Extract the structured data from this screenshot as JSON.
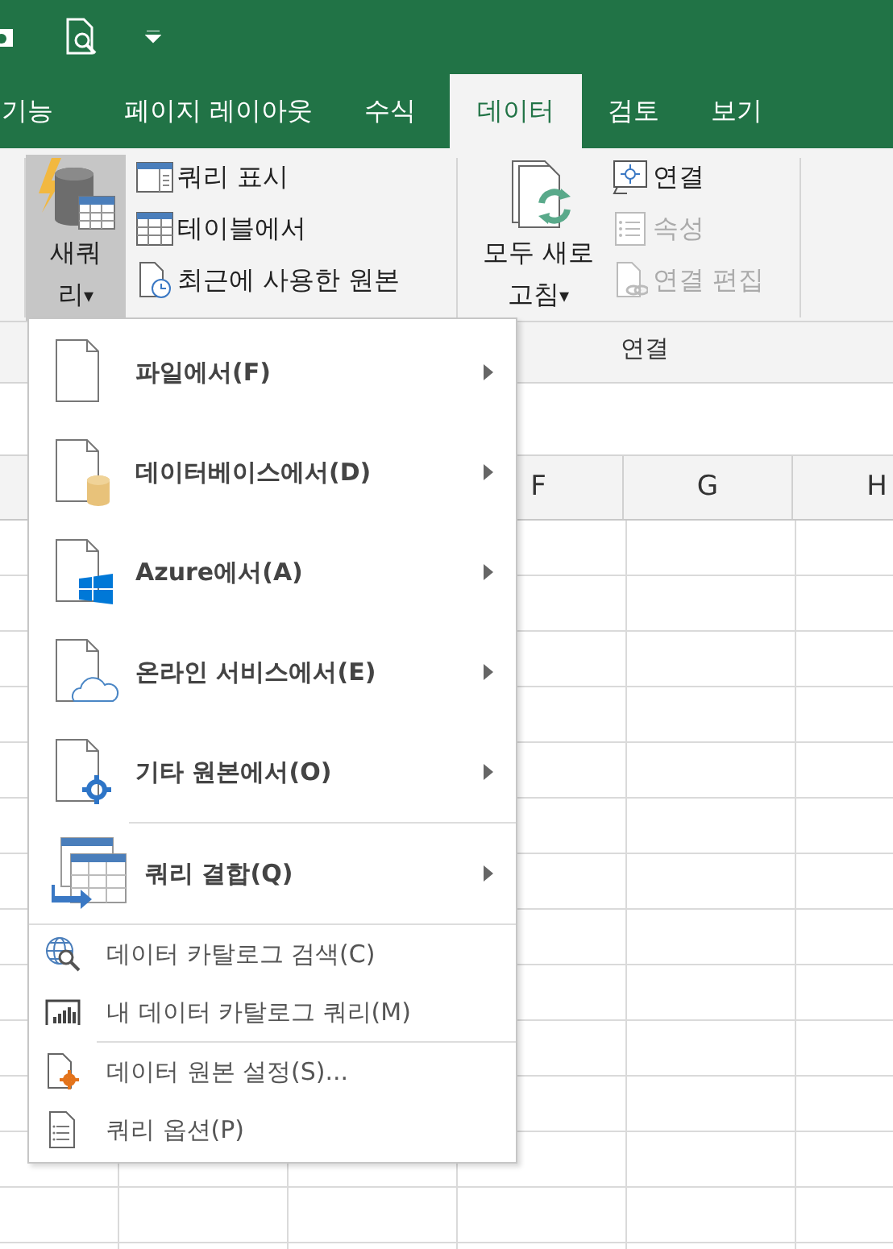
{
  "tabs": [
    {
      "label": "기능",
      "selected": false
    },
    {
      "label": "페이지 레이아웃",
      "selected": false
    },
    {
      "label": "수식",
      "selected": false
    },
    {
      "label": "데이터",
      "selected": true
    },
    {
      "label": "검토",
      "selected": false
    },
    {
      "label": "보기",
      "selected": false
    }
  ],
  "ribbon": {
    "new_query": {
      "label": "새쿼리",
      "caret": "▾",
      "selected": true
    },
    "query_commands": [
      {
        "label": "쿼리 표시"
      },
      {
        "label": "테이블에서"
      },
      {
        "label": "최근에 사용한 원본"
      }
    ],
    "refresh_all": {
      "label": "모두 새로 고침",
      "caret": "▾"
    },
    "connection_commands": [
      {
        "label": "연결",
        "disabled": false
      },
      {
        "label": "속성",
        "disabled": true
      },
      {
        "label": "연결 편집",
        "disabled": true
      }
    ],
    "group_label": "연결"
  },
  "column_headers": [
    "F",
    "G",
    "H"
  ],
  "menu": {
    "sections": [
      {
        "items": [
          {
            "kind": "large",
            "label": "파일에서(F)"
          },
          {
            "kind": "large",
            "label": "데이터베이스에서(D)"
          },
          {
            "kind": "large",
            "label": "Azure에서(A)"
          },
          {
            "kind": "large",
            "label": "온라인 서비스에서(E)"
          },
          {
            "kind": "large",
            "label": "기타 원본에서(O)"
          }
        ]
      },
      {
        "items": [
          {
            "kind": "large",
            "label": "쿼리 결합(Q)"
          }
        ]
      },
      {
        "items": [
          {
            "kind": "small",
            "label": "데이터 카탈로그 검색(C)"
          },
          {
            "kind": "small",
            "label": "내 데이터 카탈로그 쿼리(M)"
          }
        ]
      },
      {
        "items": [
          {
            "kind": "small",
            "label": "데이터 원본 설정(S)..."
          },
          {
            "kind": "small",
            "label": "쿼리 옵션(P)"
          }
        ]
      }
    ]
  }
}
